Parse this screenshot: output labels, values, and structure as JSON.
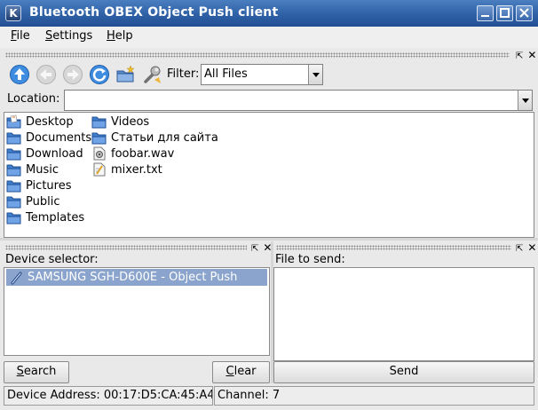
{
  "window": {
    "title": "Bluetooth OBEX Object Push client",
    "app_icon_letter": "K",
    "colors": {
      "titlebar": "#2f60a6",
      "selection": "#8aa4cd"
    }
  },
  "menu": {
    "items": [
      {
        "label": "File",
        "accel": "F"
      },
      {
        "label": "Settings",
        "accel": "S"
      },
      {
        "label": "Help",
        "accel": "H"
      }
    ]
  },
  "toolbar": {
    "icons": [
      "up-icon",
      "back-icon",
      "forward-icon",
      "reload-icon",
      "new-folder-icon",
      "filter-wrench-icon"
    ],
    "filter_label": "Filter:",
    "filter_value": "All Files"
  },
  "location": {
    "label": "Location:",
    "value": ""
  },
  "files": {
    "column1": [
      {
        "name": "Desktop",
        "icon": "desktop-folder-icon"
      },
      {
        "name": "Documents",
        "icon": "folder-icon"
      },
      {
        "name": "Download",
        "icon": "folder-icon"
      },
      {
        "name": "Music",
        "icon": "folder-icon"
      },
      {
        "name": "Pictures",
        "icon": "folder-icon"
      },
      {
        "name": "Public",
        "icon": "folder-icon"
      },
      {
        "name": "Templates",
        "icon": "folder-icon"
      }
    ],
    "column2": [
      {
        "name": "Videos",
        "icon": "folder-icon"
      },
      {
        "name": "Статьи для сайта",
        "icon": "folder-icon"
      },
      {
        "name": "foobar.wav",
        "icon": "audio-file-icon"
      },
      {
        "name": "mixer.txt",
        "icon": "text-file-icon"
      }
    ]
  },
  "device_panel": {
    "label": "Device selector:",
    "devices": [
      "SAMSUNG SGH-D600E - Object Push"
    ],
    "search_button": "Search",
    "clear_button": "Clear"
  },
  "send_panel": {
    "label": "File to send:",
    "send_button": "Send"
  },
  "status": {
    "device_address": "Device Address: 00:17:D5:CA:45:A4",
    "channel": "Channel: 7"
  }
}
